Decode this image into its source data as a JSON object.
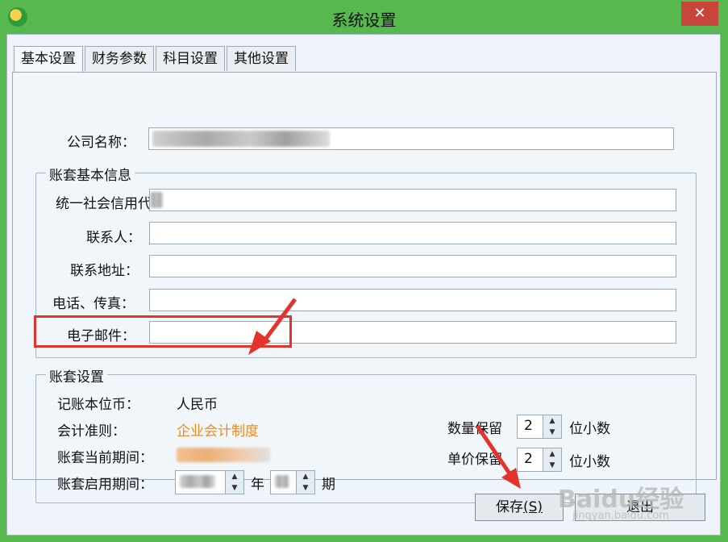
{
  "window": {
    "title": "系统设置",
    "close_label": "✕"
  },
  "tabs": [
    "基本设置",
    "财务参数",
    "科目设置",
    "其他设置"
  ],
  "company": {
    "label": "公司名称：",
    "value": ""
  },
  "basic_info": {
    "title": "账套基本信息",
    "credit_code_label": "统一社会信用代码",
    "contact_label": "联系人：",
    "address_label": "联系地址：",
    "phone_label": "电话、传真：",
    "email_label": "电子邮件："
  },
  "account_settings": {
    "title": "账套设置",
    "currency_label": "记账本位币：",
    "currency_value": "人民币",
    "standard_label": "会计准则：",
    "standard_value": "企业会计制度",
    "current_period_label": "账套当前期间：",
    "start_period_label": "账套启用期间：",
    "year_unit": "年",
    "period_unit": "期",
    "qty_label": "数量保留",
    "qty_value": "2",
    "price_label": "单价保留",
    "price_value": "2",
    "decimals_unit": "位小数"
  },
  "buttons": {
    "save": "保存",
    "save_hotkey": "(S)",
    "exit": "退出"
  },
  "watermark": {
    "text": "Baidu经验",
    "sub": "jingyan.baidu.com"
  },
  "colors": {
    "accent_orange": "#f08a1c",
    "annotation_red": "#e4332a",
    "window_green": "#57b84f"
  }
}
